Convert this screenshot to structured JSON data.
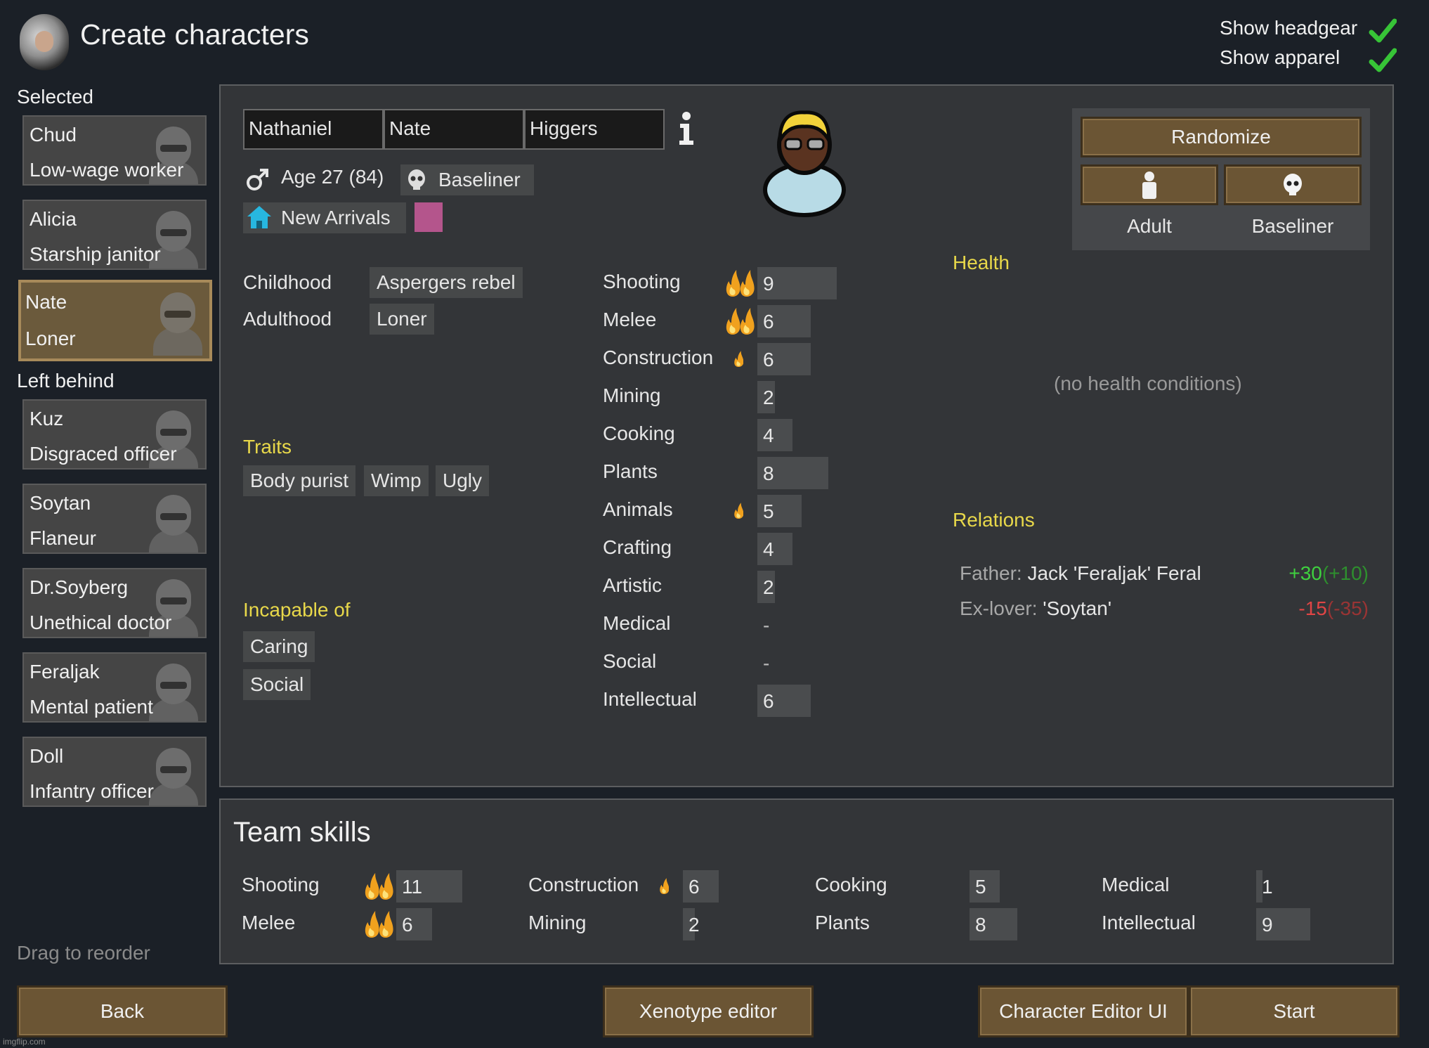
{
  "header": {
    "title": "Create characters",
    "show_headgear_label": "Show headgear",
    "show_apparel_label": "Show apparel",
    "show_headgear": true,
    "show_apparel": true
  },
  "sidebar": {
    "selected_label": "Selected",
    "left_behind_label": "Left behind",
    "drag_hint": "Drag to reorder",
    "selected": [
      {
        "name": "Chud",
        "role": "Low-wage worker"
      },
      {
        "name": "Alicia",
        "role": "Starship janitor"
      },
      {
        "name": "Nate",
        "role": "Loner"
      }
    ],
    "left_behind": [
      {
        "name": "Kuz",
        "role": "Disgraced officer"
      },
      {
        "name": "Soytan",
        "role": "Flaneur"
      },
      {
        "name": "Dr.Soyberg",
        "role": "Unethical doctor"
      },
      {
        "name": "Feraljak",
        "role": "Mental patient"
      },
      {
        "name": "Doll",
        "role": "Infantry officer"
      }
    ]
  },
  "character": {
    "first_name": "Nathaniel",
    "nick_name": "Nate",
    "last_name": "Higgers",
    "info_icon": "info-icon",
    "age_text": "Age 27 (84)",
    "xenotype": "Baseliner",
    "faction": "New Arrivals",
    "faction_color": "#b4558c",
    "childhood_label": "Childhood",
    "childhood": "Aspergers rebel",
    "adulthood_label": "Adulthood",
    "adulthood": "Loner",
    "traits_label": "Traits",
    "traits": [
      "Body purist",
      "Wimp",
      "Ugly"
    ],
    "incapable_label": "Incapable of",
    "incapable": [
      "Caring",
      "Social"
    ],
    "skills": [
      {
        "name": "Shooting",
        "value": "9",
        "level": 9,
        "passion": "major"
      },
      {
        "name": "Melee",
        "value": "6",
        "level": 6,
        "passion": "major"
      },
      {
        "name": "Construction",
        "value": "6",
        "level": 6,
        "passion": "minor"
      },
      {
        "name": "Mining",
        "value": "2",
        "level": 2,
        "passion": "none"
      },
      {
        "name": "Cooking",
        "value": "4",
        "level": 4,
        "passion": "none"
      },
      {
        "name": "Plants",
        "value": "8",
        "level": 8,
        "passion": "none"
      },
      {
        "name": "Animals",
        "value": "5",
        "level": 5,
        "passion": "minor"
      },
      {
        "name": "Crafting",
        "value": "4",
        "level": 4,
        "passion": "none"
      },
      {
        "name": "Artistic",
        "value": "2",
        "level": 2,
        "passion": "none"
      },
      {
        "name": "Medical",
        "value": "-",
        "level": 0,
        "passion": "none"
      },
      {
        "name": "Social",
        "value": "-",
        "level": 0,
        "passion": "none"
      },
      {
        "name": "Intellectual",
        "value": "6",
        "level": 6,
        "passion": "none"
      }
    ],
    "health_label": "Health",
    "health_text": "(no health conditions)",
    "relations_label": "Relations",
    "relations": [
      {
        "kind": "Father:",
        "name": "Jack 'Feraljak' Feral",
        "opinion": "+30",
        "opinion_other": "(+10)",
        "color": "#3fd13f",
        "color_dim": "#2e8f2e"
      },
      {
        "kind": "Ex-lover:",
        "name": "'Soytan'",
        "opinion": "-15",
        "opinion_other": "(-35)",
        "color": "#e04545",
        "color_dim": "#9a3434"
      }
    ]
  },
  "controls": {
    "randomize": "Randomize",
    "dev_stage_label": "Adult",
    "xenotype_label": "Baseliner"
  },
  "team": {
    "title": "Team skills",
    "skills": [
      {
        "name": "Shooting",
        "value": "11",
        "level": 11,
        "passion": "major"
      },
      {
        "name": "Melee",
        "value": "6",
        "level": 6,
        "passion": "major"
      },
      {
        "name": "Construction",
        "value": "6",
        "level": 6,
        "passion": "minor"
      },
      {
        "name": "Mining",
        "value": "2",
        "level": 2,
        "passion": "none"
      },
      {
        "name": "Cooking",
        "value": "5",
        "level": 5,
        "passion": "none"
      },
      {
        "name": "Plants",
        "value": "8",
        "level": 8,
        "passion": "none"
      },
      {
        "name": "Medical",
        "value": "1",
        "level": 1,
        "passion": "none"
      },
      {
        "name": "Intellectual",
        "value": "9",
        "level": 9,
        "passion": "none"
      }
    ]
  },
  "footer": {
    "back": "Back",
    "xenotype_editor": "Xenotype editor",
    "character_editor": "Character Editor UI",
    "start": "Start",
    "watermark": "imgflip.com"
  }
}
